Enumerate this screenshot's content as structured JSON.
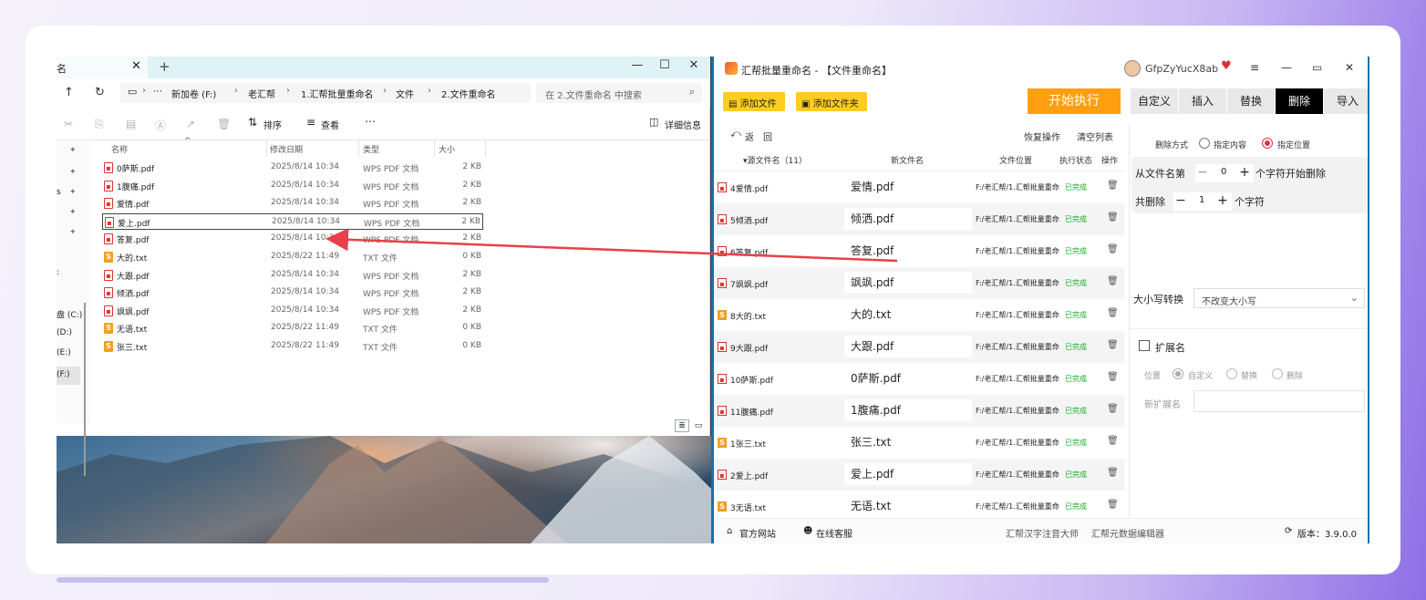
{
  "explorer": {
    "tab_label": "名",
    "tab_close": "✕",
    "tab_add": "+",
    "breadcrumb": [
      "新加卷 (F:)",
      "老汇帮",
      "1.汇帮批量重命名",
      "文件",
      "2.文件重命名"
    ],
    "breadcrumb_more": "⋯",
    "search_placeholder": "在 2.文件重命名 中搜索",
    "toolbar": {
      "sort_label": "排序",
      "view_label": "查看",
      "more_label": "⋯",
      "details_label": "详细信息"
    },
    "columns": {
      "name": "名称",
      "date": "修改日期",
      "type": "类型",
      "size": "大小"
    },
    "drives": [
      "盘 (C:)",
      "(D:)",
      "(E:)",
      "(F:)"
    ],
    "sidebar_marker_1": "s",
    "sidebar_marker_2": ":",
    "files": [
      {
        "name": "0萨斯.pdf",
        "date": "2025/8/14 10:34",
        "type": "WPS PDF 文档",
        "size": "2 KB",
        "kind": "pdf"
      },
      {
        "name": "1腹痛.pdf",
        "date": "2025/8/14 10:34",
        "type": "WPS PDF 文档",
        "size": "2 KB",
        "kind": "pdf"
      },
      {
        "name": "爱情.pdf",
        "date": "2025/8/14 10:34",
        "type": "WPS PDF 文档",
        "size": "2 KB",
        "kind": "pdf"
      },
      {
        "name": "爱上.pdf",
        "date": "2025/8/14 10:34",
        "type": "WPS PDF 文档",
        "size": "2 KB",
        "kind": "pdf"
      },
      {
        "name": "答复.pdf",
        "date": "2025/8/14 10:34",
        "type": "WPS PDF 文档",
        "size": "2 KB",
        "kind": "pdf"
      },
      {
        "name": "大的.txt",
        "date": "2025/8/22 11:49",
        "type": "TXT 文件",
        "size": "0 KB",
        "kind": "txt"
      },
      {
        "name": "大跟.pdf",
        "date": "2025/8/14 10:34",
        "type": "WPS PDF 文档",
        "size": "2 KB",
        "kind": "pdf"
      },
      {
        "name": "倾洒.pdf",
        "date": "2025/8/14 10:34",
        "type": "WPS PDF 文档",
        "size": "2 KB",
        "kind": "pdf"
      },
      {
        "name": "飒飒.pdf",
        "date": "2025/8/14 10:34",
        "type": "WPS PDF 文档",
        "size": "2 KB",
        "kind": "pdf"
      },
      {
        "name": "无语.txt",
        "date": "2025/8/22 11:49",
        "type": "TXT 文件",
        "size": "0 KB",
        "kind": "txt"
      },
      {
        "name": "张三.txt",
        "date": "2025/8/22 11:49",
        "type": "TXT 文件",
        "size": "0 KB",
        "kind": "txt"
      }
    ],
    "selected_index": 3
  },
  "app": {
    "title": "汇帮批量重命名 - 【文件重命名】",
    "username": "GfpZyYucX8ab",
    "add_file_label": "添加文件",
    "add_folder_label": "添加文件夹",
    "start_label": "开始执行",
    "mode_tabs": [
      "自定义",
      "插入",
      "替换",
      "删除",
      "导入"
    ],
    "active_mode": "删除",
    "back_label": "返",
    "back_label2": "回",
    "restore_label": "恢复操作",
    "clear_label": "清空列表",
    "grid_headers": {
      "source": "▾源文件名（11）",
      "new": "新文件名",
      "path": "文件位置",
      "status": "执行状态",
      "action": "操作"
    },
    "rows": [
      {
        "src": "4爱情.pdf",
        "new": "爱情.pdf",
        "path": "F:/老汇帮/1.汇帮批量重命名",
        "status": "已完成",
        "kind": "pdf"
      },
      {
        "src": "5倾洒.pdf",
        "new": "倾洒.pdf",
        "path": "F:/老汇帮/1.汇帮批量重命名",
        "status": "已完成",
        "kind": "pdf"
      },
      {
        "src": "6答复.pdf",
        "new": "答复.pdf",
        "path": "F:/老汇帮/1.汇帮批量重命名",
        "status": "已完成",
        "kind": "pdf"
      },
      {
        "src": "7飒飒.pdf",
        "new": "飒飒.pdf",
        "path": "F:/老汇帮/1.汇帮批量重命名",
        "status": "已完成",
        "kind": "pdf"
      },
      {
        "src": "8大的.txt",
        "new": "大的.txt",
        "path": "F:/老汇帮/1.汇帮批量重命名",
        "status": "已完成",
        "kind": "txt"
      },
      {
        "src": "9大跟.pdf",
        "new": "大跟.pdf",
        "path": "F:/老汇帮/1.汇帮批量重命名",
        "status": "已完成",
        "kind": "pdf"
      },
      {
        "src": "10萨斯.pdf",
        "new": "0萨斯.pdf",
        "path": "F:/老汇帮/1.汇帮批量重命名",
        "status": "已完成",
        "kind": "pdf"
      },
      {
        "src": "11腹痛.pdf",
        "new": "1腹痛.pdf",
        "path": "F:/老汇帮/1.汇帮批量重命名",
        "status": "已完成",
        "kind": "pdf"
      },
      {
        "src": "1张三.txt",
        "new": "张三.txt",
        "path": "F:/老汇帮/1.汇帮批量重命名",
        "status": "已完成",
        "kind": "txt"
      },
      {
        "src": "2爱上.pdf",
        "new": "爱上.pdf",
        "path": "F:/老汇帮/1.汇帮批量重命名",
        "status": "已完成",
        "kind": "pdf"
      },
      {
        "src": "3无语.txt",
        "new": "无语.txt",
        "path": "F:/老汇帮/1.汇帮批量重命名",
        "status": "已完成",
        "kind": "txt"
      }
    ],
    "panel": {
      "delete_mode_label": "删除方式",
      "opt_content": "指定内容",
      "opt_position": "指定位置",
      "selected_option": "指定位置",
      "from_prefix": "从文件名第",
      "from_value": "0",
      "from_suffix": "个字符开始删除",
      "count_prefix": "共删除",
      "count_value": "1",
      "count_suffix": "个字符",
      "case_label": "大小写转换",
      "case_value": "不改变大小写",
      "ext_label": "扩展名",
      "ext_checked": false,
      "pos_label": "位置",
      "ext_opts": [
        "自定义",
        "替换",
        "删除"
      ],
      "ext_selected": "自定义",
      "new_ext_label": "新扩展名",
      "new_ext_value": ""
    },
    "footer": {
      "website": "官方网站",
      "service": "在线客服",
      "link1": "汇帮汉字注音大师",
      "link2": "汇帮元数据编辑器",
      "version": "版本：3.9.0.0"
    }
  },
  "colors": {
    "accent_yellow": "#ffcd1f",
    "start_orange": "#ff9f10",
    "status_green": "#1aaa2a",
    "arrow_red": "#e8404a",
    "radio_red": "#e0304a"
  }
}
